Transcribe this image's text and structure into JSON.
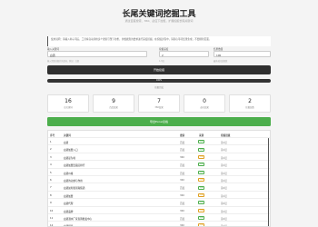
{
  "page": {
    "title": "长尾关键词挖掘工具",
    "subtitle": "通过百度搜索、360、必应下拉框，扩展挖掘长尾关键词"
  },
  "notice": "使用说明：请输入种子词后，工具将自动调用多个搜索引擎下拉框，并根据您的要求进行深度挖掘。在挖掘过程中，请耐心等待结果生成，不要刷新页面。",
  "form": {
    "keyword_label": "输入关键词",
    "keyword_value": "白酒",
    "keyword_hint": "输入需要挖掘的关键词，例如：白酒",
    "depth_label": "挖掘深度",
    "depth_value": "2",
    "depth_hint": "1-3层",
    "limit_label": "结果数量",
    "limit_value": "100",
    "limit_hint": "最多返回结果数"
  },
  "start_button": "开始挖掘",
  "progress": {
    "percent_label": "100%",
    "value": 1.0,
    "status_text": "挖掘完成"
  },
  "stats": [
    {
      "num": "16",
      "cap": "总关键词"
    },
    {
      "num": "9",
      "cap": "百度结果"
    },
    {
      "num": "7",
      "cap": "360结果"
    },
    {
      "num": "0",
      "cap": "必应结果"
    },
    {
      "num": "2",
      "cap": "挖掘层数"
    }
  ],
  "export_button": "导出Excel表格",
  "table": {
    "headers": [
      "序号",
      "关键词",
      "搜索",
      "来源",
      "挖掘层级"
    ],
    "rows": [
      {
        "no": "1",
        "kw": "白酒",
        "engine": "百度",
        "badge": "高频",
        "level": "第1层"
      },
      {
        "no": "2",
        "kw": "白酒加盟入口",
        "engine": "百度",
        "badge": "高频",
        "level": "第1层"
      },
      {
        "no": "3",
        "kw": "白酒是为啥",
        "engine": "360",
        "badge": "中频",
        "level": "第1层"
      },
      {
        "no": "4",
        "kw": "白酒加盟连锁店排行",
        "engine": "百度",
        "badge": "高频",
        "level": "第1层"
      },
      {
        "no": "5",
        "kw": "白酒价格",
        "engine": "百度",
        "badge": "高频",
        "level": "第1层"
      },
      {
        "no": "6",
        "kw": "白酒的功效与作用",
        "engine": "360",
        "badge": "中频",
        "level": "第1层"
      },
      {
        "no": "7",
        "kw": "白酒如何鉴别真假酒",
        "engine": "百度",
        "badge": "高频",
        "level": "第2层"
      },
      {
        "no": "8",
        "kw": "白酒加盟",
        "engine": "360",
        "badge": "中频",
        "level": "第1层"
      },
      {
        "no": "9",
        "kw": "白酒代理",
        "engine": "百度",
        "badge": "高频",
        "level": "第2层"
      },
      {
        "no": "10",
        "kw": "白酒品牌",
        "engine": "360",
        "badge": "中频",
        "level": "第1层"
      },
      {
        "no": "11",
        "kw": "白酒酒水厂家直销批发中心",
        "engine": "百度",
        "badge": "高频",
        "level": "第2层"
      },
      {
        "no": "12",
        "kw": "白酒招商",
        "engine": "360",
        "badge": "中频",
        "level": "第1层"
      }
    ]
  }
}
